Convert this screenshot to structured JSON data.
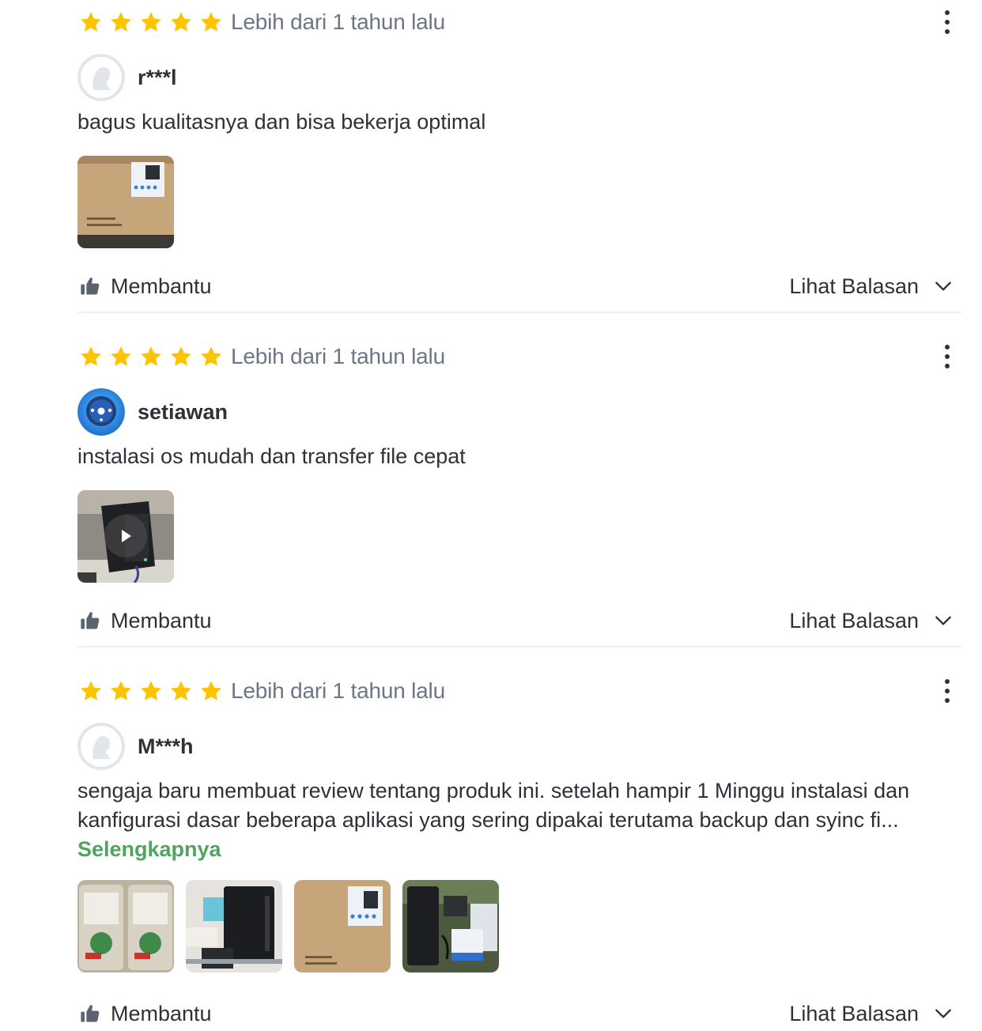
{
  "colors": {
    "star": "#ffc400",
    "text": "#2e3137",
    "muted": "#6d7588",
    "accent_green": "#4fa55f",
    "divider": "#eef0f3"
  },
  "reviews": [
    {
      "rating": 5,
      "rating_max": 5,
      "time": "Lebih dari 1 tahun lalu",
      "username": "r***l",
      "avatar_icon": "default-avatar-icon",
      "text_lines": [
        "bagus kualitasnya dan bisa bekerja optimal"
      ],
      "more_label": "",
      "media_count": 1,
      "helpful_label": "Membantu",
      "replies_label": "Lihat Balasan"
    },
    {
      "rating": 5,
      "rating_max": 5,
      "time": "Lebih dari 1 tahun lalu",
      "username": "setiawan",
      "avatar_icon": "robot-avatar-icon",
      "text_lines": [
        "instalasi os mudah dan transfer file cepat"
      ],
      "more_label": "",
      "media_count": 1,
      "helpful_label": "Membantu",
      "replies_label": "Lihat Balasan"
    },
    {
      "rating": 5,
      "rating_max": 5,
      "time": "Lebih dari 1 tahun lalu",
      "username": "M***h",
      "avatar_icon": "default-avatar-icon",
      "text_lines": [
        "sengaja baru membuat review tentang produk ini. setelah hampir 1 Minggu instalasi dan",
        "kanfigurasi dasar beberapa aplikasi yang sering dipakai terutama backup dan syinc fi..."
      ],
      "more_label": "Selengkapnya",
      "media_count": 4,
      "helpful_label": "Membantu",
      "replies_label": "Lihat Balasan"
    }
  ]
}
